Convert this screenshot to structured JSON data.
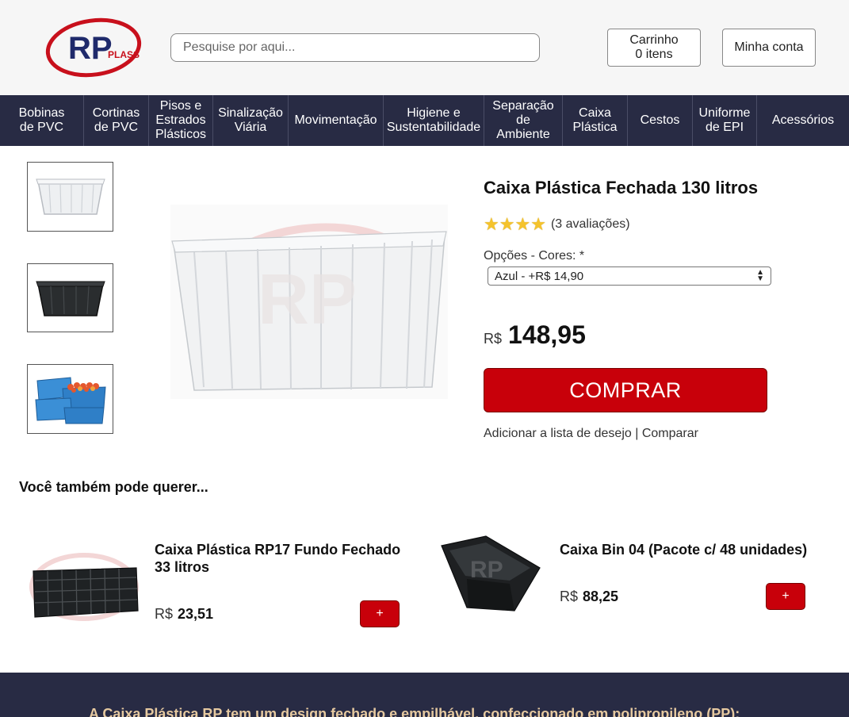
{
  "header": {
    "logo_text": "RP",
    "logo_sub": "PLASS",
    "search_placeholder": "Pesquise por aqui...",
    "cart_label": "Carrinho",
    "cart_count": "0 itens",
    "account_label": "Minha conta"
  },
  "nav": {
    "items": [
      {
        "label": "Bobinas de PVC"
      },
      {
        "label": "Cortinas de PVC"
      },
      {
        "label": "Pisos e Estrados Plásticos"
      },
      {
        "label": "Sinalização Viária"
      },
      {
        "label": "Movimentação"
      },
      {
        "label": "Higiene e Sustentabilidade"
      },
      {
        "label": "Separação de Ambiente"
      },
      {
        "label": "Caixa Plástica"
      },
      {
        "label": "Cestos"
      },
      {
        "label": "Uniforme de EPI"
      },
      {
        "label": "Acessórios"
      }
    ]
  },
  "product": {
    "title": "Caixa Plástica Fechada 130 litros",
    "rating": 4,
    "rating_max": 4,
    "reviews": "(3 avaliações)",
    "options_label": "Opções - Cores: *",
    "selected_option": "Azul - +R$ 14,90",
    "currency": "R$",
    "price": "148,95",
    "buy_label": "COMPRAR",
    "wishlist_label": "Adicionar a lista de desejo",
    "separator": "|",
    "compare_label": "Comparar",
    "thumbnails": [
      {
        "color": "white-box"
      },
      {
        "color": "black-box"
      },
      {
        "color": "blue-stacked-boxes"
      }
    ]
  },
  "related": {
    "title": "Você também pode querer...",
    "items": [
      {
        "name": "Caixa Plástica RP17 Fundo Fechado 33 litros",
        "currency": "R$",
        "price": "23,51",
        "add_label": "+"
      },
      {
        "name": "Caixa Bin 04 (Pacote c/ 48 unidades)",
        "currency": "R$",
        "price": "88,25",
        "add_label": "+"
      }
    ]
  },
  "footer": {
    "text": "A Caixa Plástica RP tem um design fechado e empilhável, confeccionado em polipropileno (PP);"
  },
  "colors": {
    "nav_bg": "#282b44",
    "accent_red": "#c8000a",
    "star": "#f5c32c"
  }
}
